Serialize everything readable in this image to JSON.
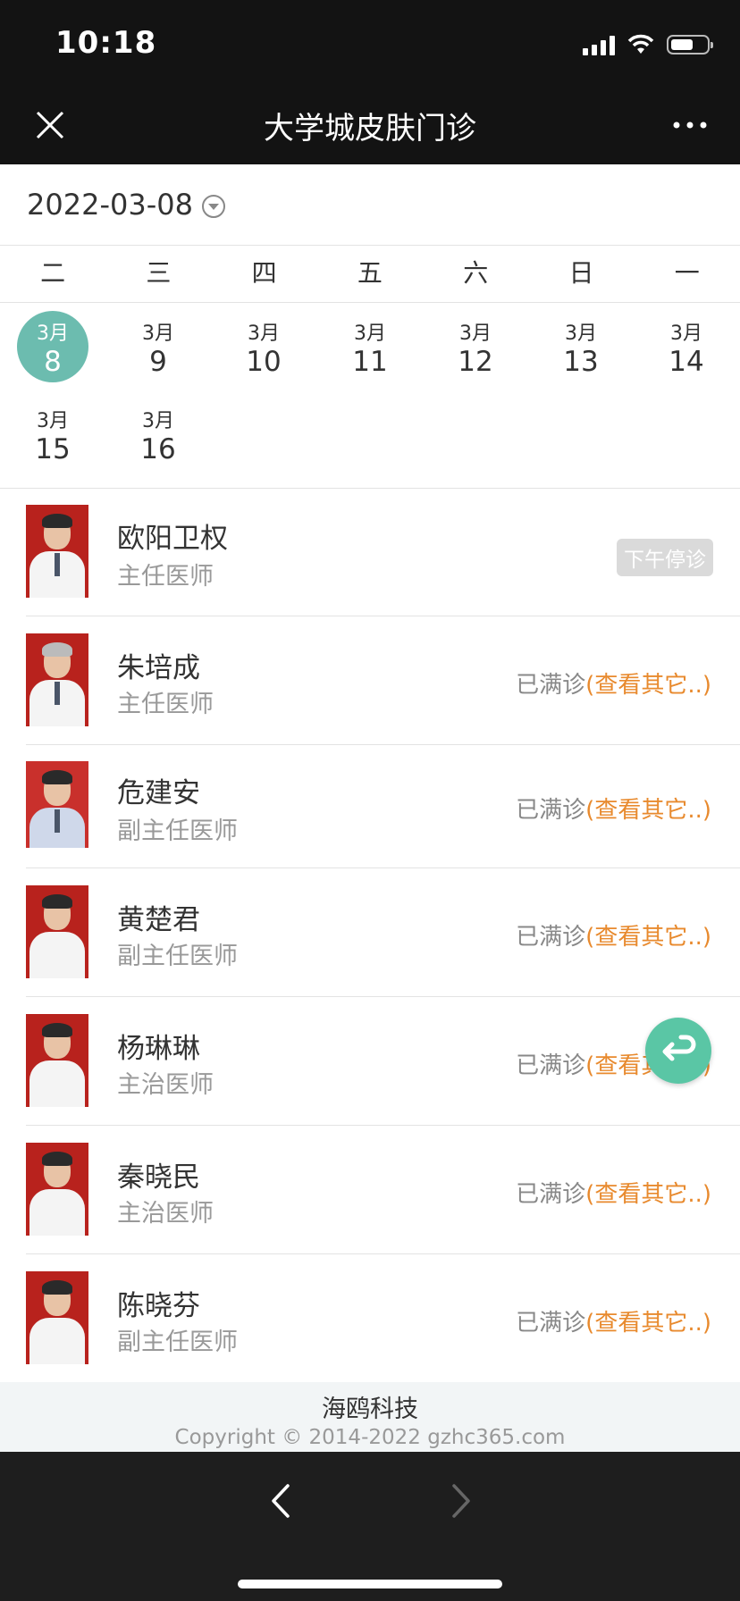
{
  "status_bar": {
    "time": "10:18"
  },
  "nav": {
    "title": "大学城皮肤门诊",
    "close_icon": "close-icon",
    "more_icon": "more-icon"
  },
  "date_selector": {
    "value": "2022-03-08"
  },
  "weekdays": [
    "二",
    "三",
    "四",
    "五",
    "六",
    "日",
    "一"
  ],
  "calendar": {
    "days": [
      {
        "month": "3月",
        "day": "8",
        "selected": true
      },
      {
        "month": "3月",
        "day": "9"
      },
      {
        "month": "3月",
        "day": "10"
      },
      {
        "month": "3月",
        "day": "11"
      },
      {
        "month": "3月",
        "day": "12"
      },
      {
        "month": "3月",
        "day": "13"
      },
      {
        "month": "3月",
        "day": "14"
      },
      {
        "month": "3月",
        "day": "15"
      },
      {
        "month": "3月",
        "day": "16"
      }
    ]
  },
  "doctors": [
    {
      "name": "欧阳卫权",
      "title": "主任医师",
      "badge": "下午停诊"
    },
    {
      "name": "朱培成",
      "title": "主任医师",
      "status": "已满诊",
      "link": "(查看其它..)"
    },
    {
      "name": "危建安",
      "title": "副主任医师",
      "status": "已满诊",
      "link": "(查看其它..)"
    },
    {
      "name": "黄楚君",
      "title": "副主任医师",
      "status": "已满诊",
      "link": "(查看其它..)"
    },
    {
      "name": "杨琳琳",
      "title": "主治医师",
      "status": "已满诊",
      "link": "(查看其它..)"
    },
    {
      "name": "秦晓民",
      "title": "主治医师",
      "status": "已满诊",
      "link": "(查看其它..)"
    },
    {
      "name": "陈晓芬",
      "title": "副主任医师",
      "status": "已满诊",
      "link": "(查看其它..)"
    }
  ],
  "footer": {
    "brand": "海鸥科技",
    "copyright": "Copyright © 2014-2022 gzhc365.com"
  },
  "colors": {
    "accent": "#6cbcaf",
    "link": "#e88a2e",
    "fab": "#5ac6a5",
    "bar": "#131313"
  }
}
